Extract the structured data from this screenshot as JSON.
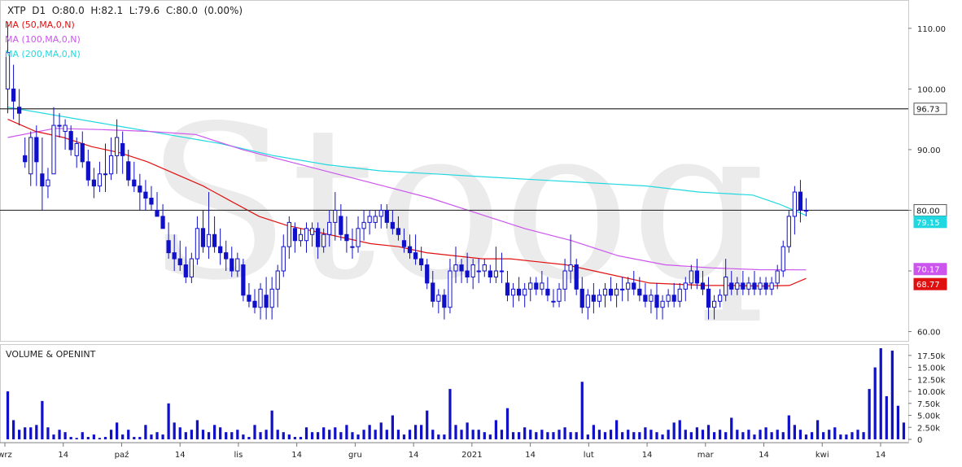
{
  "header": {
    "quote_line": "XTP  D1  O:80.0  H:82.1  L:79.6  C:80.0  (0.00%)",
    "ma_labels": [
      {
        "text": "MA (50,MA,0,N)",
        "color": "#e01010"
      },
      {
        "text": "MA (100,MA,0,N)",
        "color": "#cc55ee"
      },
      {
        "text": "MA (200,MA,0,N)",
        "color": "#22d8e0"
      }
    ]
  },
  "watermark": "Stooq",
  "colors": {
    "candle": "#1010c8",
    "volume": "#1010c8",
    "ma50": "#e01010",
    "ma100": "#cc55ee",
    "ma200": "#22d8e0",
    "hline": "#333333",
    "price_tag_bg": "#ffffff",
    "ma50_tag": "#e01010",
    "ma100_tag": "#cc55ee",
    "ma200_tag": "#22d8e0"
  },
  "chart_data": [
    {
      "type": "candlestick",
      "title": "XTP D1",
      "y_ticks": [
        "60.00",
        "70.00",
        "80.00",
        "90.00",
        "100.00",
        "110.00"
      ],
      "ylim": [
        59,
        114
      ],
      "x_labels": [
        "wrz",
        "14",
        "paź",
        "14",
        "lis",
        "14",
        "gru",
        "14",
        "2021",
        "14",
        "lut",
        "14",
        "mar",
        "14",
        "kwi",
        "14"
      ],
      "horizontal_lines": [
        96.73,
        80.0
      ],
      "price_tags": [
        {
          "label": "96.73",
          "value": 96.73,
          "kind": "line"
        },
        {
          "label": "80.00",
          "value": 80.0,
          "kind": "line"
        },
        {
          "label": "79.15",
          "value": 79.15,
          "kind": "ma200"
        },
        {
          "label": "70.17",
          "value": 70.17,
          "kind": "ma100"
        },
        {
          "label": "68.77",
          "value": 68.77,
          "kind": "ma50"
        }
      ],
      "candles": [
        [
          100,
          111,
          96,
          106
        ],
        [
          100,
          104,
          95,
          98
        ],
        [
          97,
          100,
          94,
          96
        ],
        [
          89,
          92,
          87,
          88
        ],
        [
          86,
          93,
          84,
          92
        ],
        [
          92,
          94,
          84,
          88
        ],
        [
          86,
          92,
          80,
          84
        ],
        [
          84,
          87,
          82,
          85
        ],
        [
          86,
          97,
          86,
          94
        ],
        [
          94,
          96,
          92,
          94
        ],
        [
          93,
          95,
          90,
          94
        ],
        [
          93,
          94,
          89,
          90
        ],
        [
          89,
          92,
          87,
          91
        ],
        [
          91,
          93,
          87,
          88
        ],
        [
          88,
          90,
          84,
          85
        ],
        [
          85,
          87,
          82,
          84
        ],
        [
          84,
          88,
          83,
          86
        ],
        [
          86,
          91,
          83,
          86
        ],
        [
          86,
          92,
          85,
          89
        ],
        [
          89,
          95,
          86,
          92
        ],
        [
          91,
          93,
          86,
          89
        ],
        [
          88,
          90,
          84,
          85
        ],
        [
          85,
          88,
          83,
          84
        ],
        [
          84,
          86,
          80,
          83
        ],
        [
          83,
          85,
          80,
          82
        ],
        [
          82,
          84,
          80,
          81
        ],
        [
          80,
          83,
          79,
          79
        ],
        [
          79,
          81,
          77,
          77
        ],
        [
          75,
          78,
          72,
          73
        ],
        [
          73,
          76,
          70,
          72
        ],
        [
          72,
          75,
          70,
          71
        ],
        [
          71,
          74,
          68,
          69
        ],
        [
          69,
          73,
          68,
          72
        ],
        [
          72,
          79,
          71,
          77
        ],
        [
          77,
          80,
          73,
          74
        ],
        [
          74,
          83,
          72,
          76
        ],
        [
          76,
          79,
          73,
          74
        ],
        [
          74,
          77,
          71,
          73
        ],
        [
          73,
          75,
          70,
          72
        ],
        [
          72,
          74,
          69,
          70
        ],
        [
          70,
          73,
          69,
          72
        ],
        [
          71,
          72,
          65,
          66
        ],
        [
          66,
          68,
          64,
          65
        ],
        [
          65,
          67,
          63,
          64
        ],
        [
          64,
          68,
          62,
          67
        ],
        [
          66,
          69,
          62,
          64
        ],
        [
          64,
          69,
          62,
          67
        ],
        [
          67,
          71,
          64,
          70
        ],
        [
          70,
          76,
          69,
          74
        ],
        [
          74,
          79,
          72,
          78
        ],
        [
          77,
          78,
          73,
          75
        ],
        [
          75,
          77,
          74,
          76
        ],
        [
          75,
          78,
          73,
          77
        ],
        [
          76,
          78,
          74,
          77
        ],
        [
          77,
          78,
          72,
          74
        ],
        [
          74,
          77,
          73,
          76
        ],
        [
          76,
          80,
          74,
          78
        ],
        [
          78,
          83,
          75,
          80
        ],
        [
          79,
          81,
          75,
          76
        ],
        [
          76,
          79,
          73,
          75
        ],
        [
          74,
          77,
          72,
          74
        ],
        [
          74,
          79,
          73,
          77
        ],
        [
          77,
          80,
          75,
          78
        ],
        [
          78,
          80,
          76,
          79
        ],
        [
          78,
          80,
          77,
          79
        ],
        [
          79,
          81,
          77,
          80
        ],
        [
          80,
          81,
          77,
          78
        ],
        [
          78,
          80,
          76,
          77
        ],
        [
          77,
          79,
          75,
          76
        ],
        [
          75,
          77,
          73,
          74
        ],
        [
          74,
          76,
          72,
          73
        ],
        [
          73,
          76,
          71,
          72
        ],
        [
          72,
          74,
          70,
          71
        ],
        [
          71,
          72,
          67,
          68
        ],
        [
          68,
          70,
          64,
          65
        ],
        [
          65,
          67,
          63,
          66
        ],
        [
          66,
          67,
          62,
          64
        ],
        [
          64,
          72,
          63,
          70
        ],
        [
          70,
          74,
          68,
          71
        ],
        [
          71,
          72,
          68,
          70
        ],
        [
          70,
          73,
          68,
          69
        ],
        [
          69,
          72,
          67,
          71
        ],
        [
          70,
          72,
          68,
          70
        ],
        [
          70,
          72,
          69,
          71
        ],
        [
          70,
          71,
          68,
          69
        ],
        [
          69,
          74,
          68,
          70
        ],
        [
          70,
          73,
          68,
          70
        ],
        [
          68,
          70,
          65,
          66
        ],
        [
          66,
          68,
          64,
          67
        ],
        [
          67,
          69,
          65,
          66
        ],
        [
          66,
          68,
          64,
          67
        ],
        [
          67,
          69,
          65,
          68
        ],
        [
          68,
          69,
          66,
          67
        ],
        [
          67,
          70,
          66,
          68
        ],
        [
          67,
          69,
          65,
          66
        ],
        [
          65,
          67,
          64,
          65
        ],
        [
          65,
          68,
          64,
          67
        ],
        [
          67,
          72,
          65,
          70
        ],
        [
          70,
          76,
          68,
          71
        ],
        [
          71,
          72,
          66,
          67
        ],
        [
          67,
          69,
          63,
          64
        ],
        [
          64,
          67,
          62,
          66
        ],
        [
          66,
          68,
          63,
          65
        ],
        [
          65,
          67,
          64,
          66
        ],
        [
          66,
          68,
          64,
          67
        ],
        [
          67,
          69,
          65,
          66
        ],
        [
          66,
          68,
          64,
          67
        ],
        [
          67,
          69,
          65,
          67
        ],
        [
          67,
          69,
          65,
          68
        ],
        [
          68,
          70,
          66,
          67
        ],
        [
          67,
          69,
          65,
          66
        ],
        [
          66,
          68,
          64,
          65
        ],
        [
          65,
          67,
          63,
          66
        ],
        [
          66,
          68,
          62,
          64
        ],
        [
          64,
          66,
          62,
          65
        ],
        [
          65,
          67,
          64,
          66
        ],
        [
          66,
          68,
          64,
          65
        ],
        [
          65,
          68,
          64,
          67
        ],
        [
          67,
          69,
          65,
          68
        ],
        [
          68,
          71,
          67,
          70
        ],
        [
          70,
          72,
          67,
          68
        ],
        [
          68,
          70,
          66,
          67
        ],
        [
          67,
          69,
          62,
          64
        ],
        [
          64,
          66,
          62,
          65
        ],
        [
          65,
          67,
          64,
          66
        ],
        [
          66,
          72,
          65,
          69
        ],
        [
          68,
          70,
          66,
          67
        ],
        [
          67,
          69,
          66,
          68
        ],
        [
          68,
          70,
          66,
          67
        ],
        [
          67,
          69,
          66,
          68
        ],
        [
          68,
          70,
          66,
          67
        ],
        [
          67,
          69,
          66,
          68
        ],
        [
          68,
          69,
          66,
          67
        ],
        [
          67,
          69,
          66,
          68
        ],
        [
          68,
          71,
          67,
          70
        ],
        [
          70,
          75,
          69,
          74
        ],
        [
          74,
          80,
          73,
          79
        ],
        [
          79,
          84,
          76,
          83
        ],
        [
          83,
          85,
          78,
          80
        ],
        [
          80,
          82,
          79,
          80
        ]
      ],
      "ma50": [
        [
          0,
          95
        ],
        [
          5,
          93
        ],
        [
          10,
          92
        ],
        [
          15,
          90.5
        ],
        [
          20,
          89.5
        ],
        [
          25,
          88
        ],
        [
          30,
          86
        ],
        [
          35,
          84
        ],
        [
          40,
          81.5
        ],
        [
          45,
          79
        ],
        [
          50,
          77.5
        ],
        [
          55,
          76.5
        ],
        [
          60,
          75.5
        ],
        [
          65,
          74.5
        ],
        [
          70,
          74
        ],
        [
          75,
          73
        ],
        [
          80,
          72.5
        ],
        [
          85,
          72
        ],
        [
          90,
          72
        ],
        [
          95,
          71.5
        ],
        [
          100,
          71
        ],
        [
          105,
          70
        ],
        [
          110,
          69
        ],
        [
          115,
          68
        ],
        [
          120,
          67.8
        ],
        [
          125,
          67.6
        ],
        [
          130,
          67.6
        ],
        [
          135,
          67.5
        ],
        [
          140,
          67.6
        ],
        [
          143,
          68.77
        ]
      ],
      "ma100": [
        [
          0,
          92
        ],
        [
          10,
          93.5
        ],
        [
          20,
          93.3
        ],
        [
          30,
          93
        ],
        [
          40,
          92.5
        ],
        [
          50,
          90
        ],
        [
          60,
          88
        ],
        [
          70,
          86
        ],
        [
          80,
          84
        ],
        [
          90,
          82
        ],
        [
          100,
          79.5
        ],
        [
          110,
          77
        ],
        [
          120,
          75
        ],
        [
          130,
          72.5
        ],
        [
          140,
          71
        ],
        [
          150,
          70.5
        ],
        [
          160,
          70.2
        ],
        [
          170,
          70.17
        ]
      ],
      "ma200": [
        [
          0,
          97
        ],
        [
          10,
          95.5
        ],
        [
          20,
          94
        ],
        [
          30,
          92.5
        ],
        [
          40,
          91
        ],
        [
          50,
          89
        ],
        [
          60,
          87.5
        ],
        [
          70,
          86.5
        ],
        [
          80,
          86
        ],
        [
          90,
          85.5
        ],
        [
          100,
          85
        ],
        [
          110,
          84.5
        ],
        [
          120,
          84
        ],
        [
          130,
          83
        ],
        [
          140,
          82.5
        ],
        [
          145,
          81
        ],
        [
          150,
          79.15
        ]
      ],
      "volume": {
        "y_ticks": [
          "0",
          "2.50k",
          "5.00k",
          "7.50k",
          "10.00k",
          "12.50k",
          "15.00k",
          "17.50k"
        ],
        "ylim": [
          0,
          19
        ],
        "title": "VOLUME & OPENINT",
        "values": [
          10,
          4,
          2,
          2.5,
          2.5,
          3,
          8,
          2.5,
          1,
          2,
          1.5,
          0.5,
          0.3,
          1.5,
          0.5,
          1,
          0.3,
          0.5,
          2,
          3.5,
          1,
          2,
          0.5,
          0.5,
          3,
          1,
          1.5,
          1,
          7.5,
          3.5,
          2.5,
          1.5,
          2,
          4,
          2,
          1.5,
          3,
          2.5,
          1.5,
          1.5,
          2,
          1,
          0.5,
          3,
          1.5,
          2,
          6,
          2,
          1.5,
          1,
          0.5,
          0.5,
          2.5,
          1.5,
          1.5,
          2.5,
          2,
          2.5,
          1.5,
          3,
          1.5,
          1,
          2,
          3,
          2,
          3.5,
          2,
          5,
          2,
          1,
          2,
          3,
          3,
          6,
          2,
          1,
          1,
          10.5,
          3,
          2,
          3.5,
          2,
          2,
          1.5,
          1,
          4,
          2,
          6.5,
          1.5,
          1.5,
          2.5,
          2,
          1.5,
          2,
          1.5,
          1.5,
          2,
          2.5,
          1.5,
          1.5,
          12,
          1,
          3,
          2,
          1.5,
          2,
          4,
          1.5,
          2,
          1.5,
          1.5,
          2.5,
          2,
          1.5,
          1,
          2,
          3.5,
          4,
          2,
          1.5,
          2.5,
          2,
          3,
          1.5,
          2,
          1.5,
          4.5,
          2,
          1.5,
          2,
          1,
          2,
          2.5,
          1.5,
          2,
          1.5,
          5,
          3,
          2,
          1,
          1.5,
          4,
          1.5,
          2,
          2.5,
          1,
          1,
          1.5,
          2,
          1.5,
          10.5,
          15,
          19,
          9,
          18.5,
          7,
          3.5
        ]
      }
    }
  ]
}
